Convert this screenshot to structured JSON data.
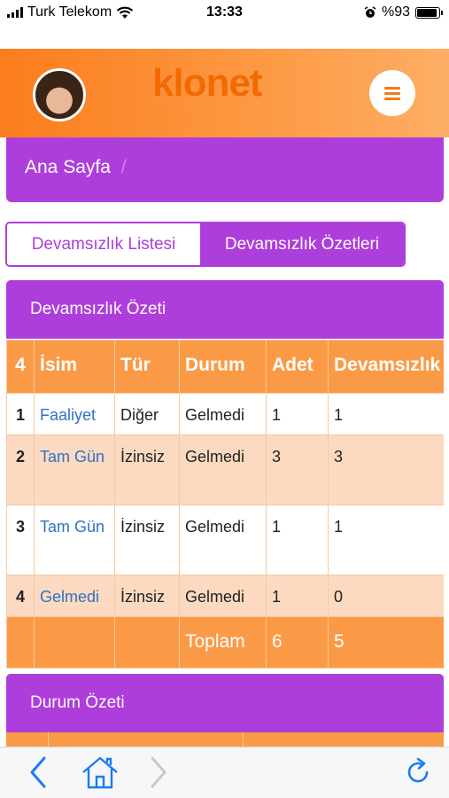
{
  "status_bar": {
    "carrier": "Turk Telekom",
    "time": "13:33",
    "battery_text": "%93",
    "battery_level": 0.93
  },
  "header": {
    "logo_text": "klonet",
    "menu_icon": "hamburger-icon",
    "avatar": "user-avatar"
  },
  "breadcrumb": {
    "home_label": "Ana Sayfa",
    "separator": "/"
  },
  "tabs": [
    {
      "label": "Devamsızlık Listesi",
      "active": false
    },
    {
      "label": "Devamsızlık Özetleri",
      "active": true
    }
  ],
  "summary_panel": {
    "title": "Devamsızlık Özeti",
    "columns": [
      "4",
      "İsim",
      "Tür",
      "Durum",
      "Adet",
      "Devamsızlık"
    ],
    "rows": [
      {
        "no": "1",
        "name": "Faaliyet",
        "type": "Diğer",
        "status": "Gelmedi",
        "count": "1",
        "absence": "1"
      },
      {
        "no": "2",
        "name": "Tam Gün",
        "type": "İzinsiz",
        "status": "Gelmedi",
        "count": "3",
        "absence": "3"
      },
      {
        "no": "3",
        "name": "Tam Gün",
        "type": "İzinsiz",
        "status": "Gelmedi",
        "count": "1",
        "absence": "1"
      },
      {
        "no": "4",
        "name": "Gelmedi",
        "type": "İzinsiz",
        "status": "Gelmedi",
        "count": "1",
        "absence": "0"
      }
    ],
    "total_label": "Toplam",
    "total_count": "6",
    "total_absence": "5"
  },
  "status_panel": {
    "title": "Durum Özeti"
  },
  "browser_bar": {
    "icons": [
      "back-icon",
      "home-icon",
      "forward-icon",
      "reload-icon"
    ]
  },
  "colors": {
    "purple": "#ae3edb",
    "orange": "#fb9a46",
    "row_alt": "#fbdac1",
    "link": "#2f72c6",
    "ios_blue": "#1a7cf0"
  }
}
